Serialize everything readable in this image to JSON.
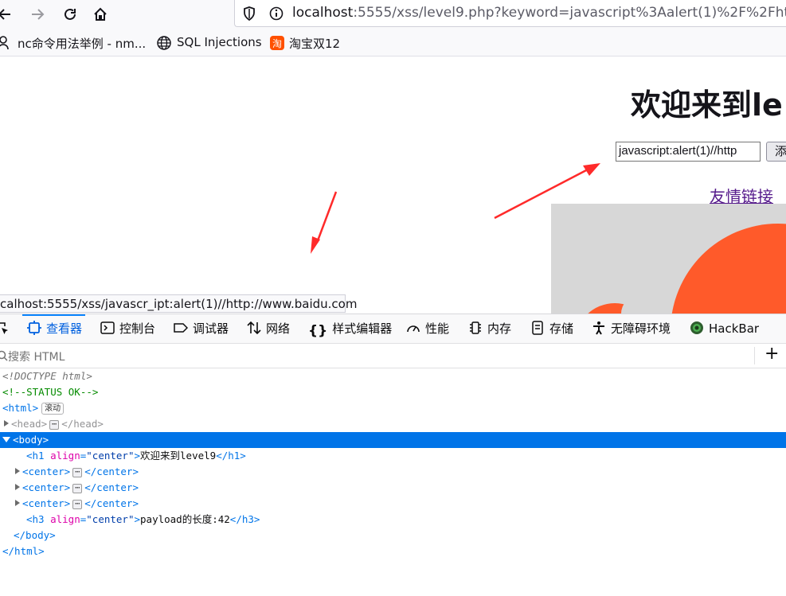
{
  "browser": {
    "url_host": "localhost",
    "url_rest": ":5555/xss/level9.php?keyword=javascript%3Aalert(1)%2F%2Fhttp%",
    "bookmarks": [
      {
        "label": "nc命令用法举例 - nm..."
      },
      {
        "label": "SQL Injections"
      },
      {
        "label": "淘宝双12"
      }
    ]
  },
  "page": {
    "heading": "欢迎来到le",
    "input_value": "javascript:alert(1)//http",
    "add_button": "添",
    "friend_link": "友情链接",
    "status_tip": "calhost:5555/xss/javascr_ipt:alert(1)//http://www.baidu.com"
  },
  "devtools": {
    "tabs": [
      {
        "label": "查看器"
      },
      {
        "label": "控制台"
      },
      {
        "label": "调试器"
      },
      {
        "label": "网络"
      },
      {
        "label": "样式编辑器"
      },
      {
        "label": "性能"
      },
      {
        "label": "内存"
      },
      {
        "label": "存储"
      },
      {
        "label": "无障碍环境"
      },
      {
        "label": "HackBar"
      }
    ],
    "search_placeholder": "搜索 HTML",
    "tree": {
      "doctype": "<!DOCTYPE html>",
      "comment": "<!--STATUS OK-->",
      "html_open": "<html>",
      "scroll_badge": "滚动",
      "head_open": "<head>",
      "head_close": "</head>",
      "body_open": "<body>",
      "h1_text": "欢迎来到level9",
      "center_open": "<center>",
      "center_close": "</center>",
      "h3_text": "payload的长度:42",
      "body_close": "</body>",
      "html_close": "</html>",
      "align_attr": "align",
      "align_val": "\"center\""
    }
  }
}
